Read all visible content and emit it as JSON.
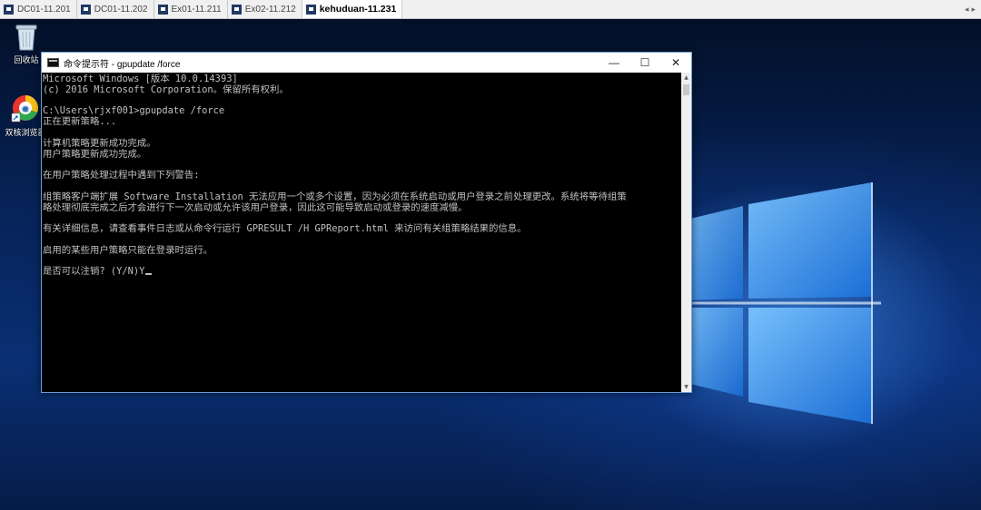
{
  "tabbar": {
    "tabs": [
      {
        "label": "DC01-11.201",
        "active": false
      },
      {
        "label": "DC01-11.202",
        "active": false
      },
      {
        "label": "Ex01-11.211",
        "active": false
      },
      {
        "label": "Ex02-11.212",
        "active": false
      },
      {
        "label": "kehuduan-11.231",
        "active": true
      }
    ],
    "scroll_left": "◂",
    "scroll_right": "▸"
  },
  "desktop": {
    "icons": [
      {
        "label": "回收站"
      },
      {
        "label": "双核浏览器"
      }
    ]
  },
  "cmd_window": {
    "title": "命令提示符 - gpupdate  /force",
    "minimize": "—",
    "maximize": "☐",
    "close": "✕",
    "lines": [
      "Microsoft Windows [版本 10.0.14393]",
      "(c) 2016 Microsoft Corporation。保留所有权利。",
      "",
      "C:\\Users\\rjxf001>gpupdate /force",
      "正在更新策略...",
      "",
      "计算机策略更新成功完成。",
      "用户策略更新成功完成。",
      "",
      "在用户策略处理过程中遇到下列警告:",
      "",
      "组策略客户端扩展 Software Installation 无法应用一个或多个设置，因为必须在系统启动或用户登录之前处理更改。系统将等待组策",
      "略处理彻底完成之后才会进行下一次启动或允许该用户登录，因此这可能导致启动或登录的速度减慢。",
      "",
      "有关详细信息，请查看事件日志或从命令行运行 GPRESULT /H GPReport.html 来访问有关组策略结果的信息。",
      "",
      "启用的某些用户策略只能在登录时运行。",
      "",
      "是否可以注销? (Y/N)Y"
    ],
    "scroll_up": "▲",
    "scroll_down": "▼"
  },
  "colors": {
    "console_bg": "#000000",
    "console_text": "#c0c0c0",
    "window_border": "#6b9bd6",
    "desktop_glow": "#4fa3ff"
  }
}
